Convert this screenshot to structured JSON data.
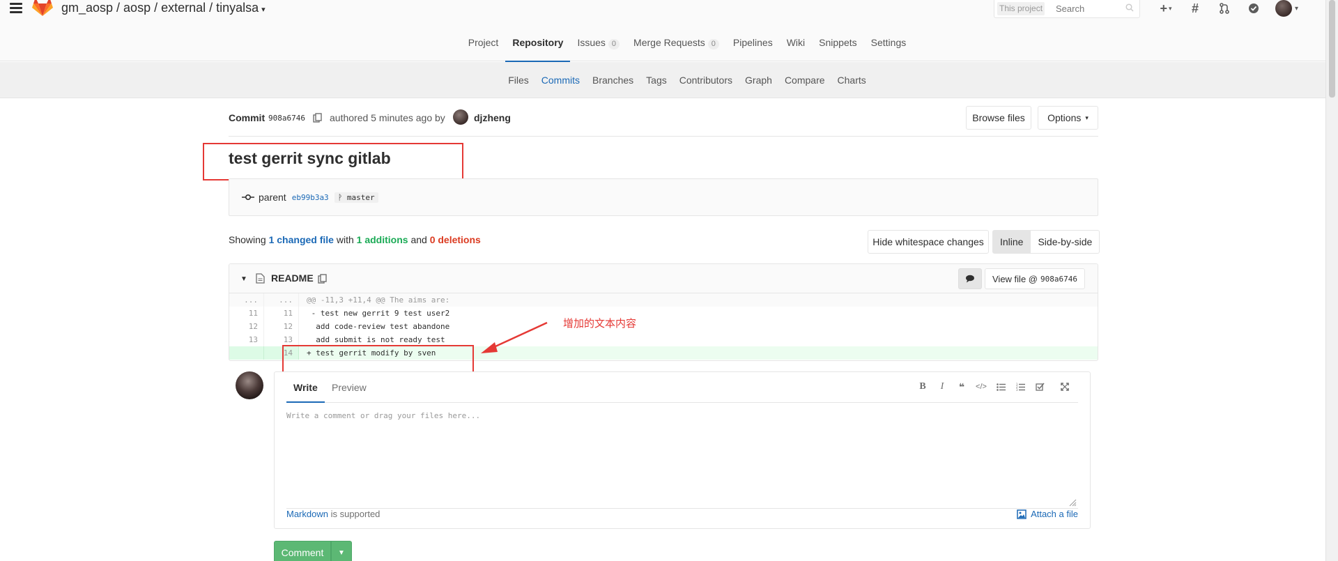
{
  "header": {
    "project_path": "gm_aosp / aosp / external / tinyalsa",
    "search_scope": "This project",
    "search_placeholder": "Search"
  },
  "main_nav": [
    {
      "label": "Project",
      "active": false
    },
    {
      "label": "Repository",
      "active": true
    },
    {
      "label": "Issues",
      "badge": "0",
      "active": false
    },
    {
      "label": "Merge Requests",
      "badge": "0",
      "active": false
    },
    {
      "label": "Pipelines",
      "active": false
    },
    {
      "label": "Wiki",
      "active": false
    },
    {
      "label": "Snippets",
      "active": false
    },
    {
      "label": "Settings",
      "active": false
    }
  ],
  "sub_nav": [
    {
      "label": "Files",
      "active": false
    },
    {
      "label": "Commits",
      "active": true
    },
    {
      "label": "Branches",
      "active": false
    },
    {
      "label": "Tags",
      "active": false
    },
    {
      "label": "Contributors",
      "active": false
    },
    {
      "label": "Graph",
      "active": false
    },
    {
      "label": "Compare",
      "active": false
    },
    {
      "label": "Charts",
      "active": false
    }
  ],
  "commit": {
    "label": "Commit",
    "sha": "908a6746",
    "authored": "authored 5 minutes ago by",
    "author": "djzheng",
    "browse_files": "Browse files",
    "options": "Options",
    "title": "test gerrit sync gitlab",
    "parent_label": "parent",
    "parent_sha": "eb99b3a3",
    "branch": "master"
  },
  "stats": {
    "showing": "Showing",
    "changed": "1 changed file",
    "with": "with",
    "additions": "1 additions",
    "and": "and",
    "deletions": "0 deletions"
  },
  "diff_controls": {
    "hide_whitespace": "Hide whitespace changes",
    "inline": "Inline",
    "side_by_side": "Side-by-side"
  },
  "diff_file": {
    "name": "README",
    "view_file_label": "View file @",
    "view_file_sha": "908a6746",
    "lines": [
      {
        "type": "match",
        "old": "...",
        "new": "...",
        "code": "@@ -11,3 +11,4 @@ The aims are:"
      },
      {
        "type": "context",
        "old": "11",
        "new": "11",
        "code": " - test new gerrit 9 test user2"
      },
      {
        "type": "context",
        "old": "12",
        "new": "12",
        "code": "  add code-review test abandone"
      },
      {
        "type": "context",
        "old": "13",
        "new": "13",
        "code": "  add submit is not ready test"
      },
      {
        "type": "added",
        "old": "",
        "new": "14",
        "code": "+ test gerrit modify by sven"
      }
    ]
  },
  "annotation": "增加的文本内容",
  "annotation_color": "#e53935",
  "comment_form": {
    "tab_write": "Write",
    "tab_preview": "Preview",
    "placeholder": "Write a comment or drag your files here...",
    "markdown_link": "Markdown",
    "markdown_rest": "is supported",
    "attach": "Attach a file",
    "submit": "Comment"
  },
  "colors": {
    "accent": "#1b69b6",
    "added_bg": "#ecfdf0",
    "success": "#5cb874",
    "danger": "#db3b21"
  }
}
